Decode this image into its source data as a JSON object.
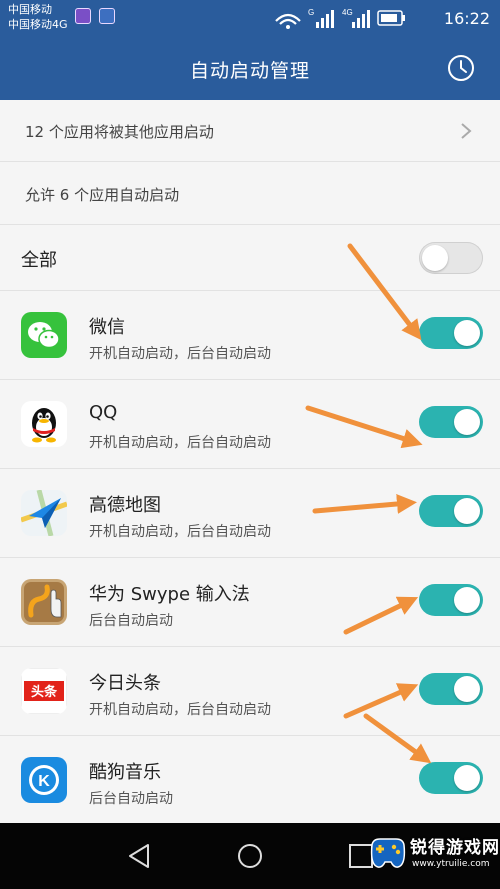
{
  "status_bar": {
    "carrier1": "中国移动",
    "carrier2": "中国移动4G",
    "net1": "G",
    "net2": "4G",
    "time": "16:22"
  },
  "header": {
    "title": "自动启动管理"
  },
  "summary": {
    "launched_by_others": "12 个应用将被其他应用启动",
    "allowed_count_text": "允许 6 个应用自动启动"
  },
  "all": {
    "label": "全部",
    "enabled": false
  },
  "apps": [
    {
      "name": "微信",
      "desc": "开机自动启动，后台自动启动",
      "enabled": true,
      "icon": "wechat-icon"
    },
    {
      "name": "QQ",
      "desc": "开机自动启动，后台自动启动",
      "enabled": true,
      "icon": "qq-icon"
    },
    {
      "name": "高德地图",
      "desc": "开机自动启动，后台自动启动",
      "enabled": true,
      "icon": "amap-icon"
    },
    {
      "name": "华为 Swype 输入法",
      "desc": "后台自动启动",
      "enabled": true,
      "icon": "swype-icon"
    },
    {
      "name": "今日头条",
      "desc": "开机自动启动，后台自动启动",
      "enabled": true,
      "icon": "toutiao-icon"
    },
    {
      "name": "酷狗音乐",
      "desc": "后台自动启动",
      "enabled": true,
      "icon": "kugou-icon"
    }
  ],
  "icon_toutiao_text": "头条",
  "icon_kugou_text": "K",
  "watermark": {
    "title": "锐得游戏网",
    "url": "www.ytruilie.com"
  },
  "colors": {
    "primary": "#2a5c9c",
    "toggle_on": "#2bb3b0",
    "annotation_arrow": "#f0913c"
  }
}
